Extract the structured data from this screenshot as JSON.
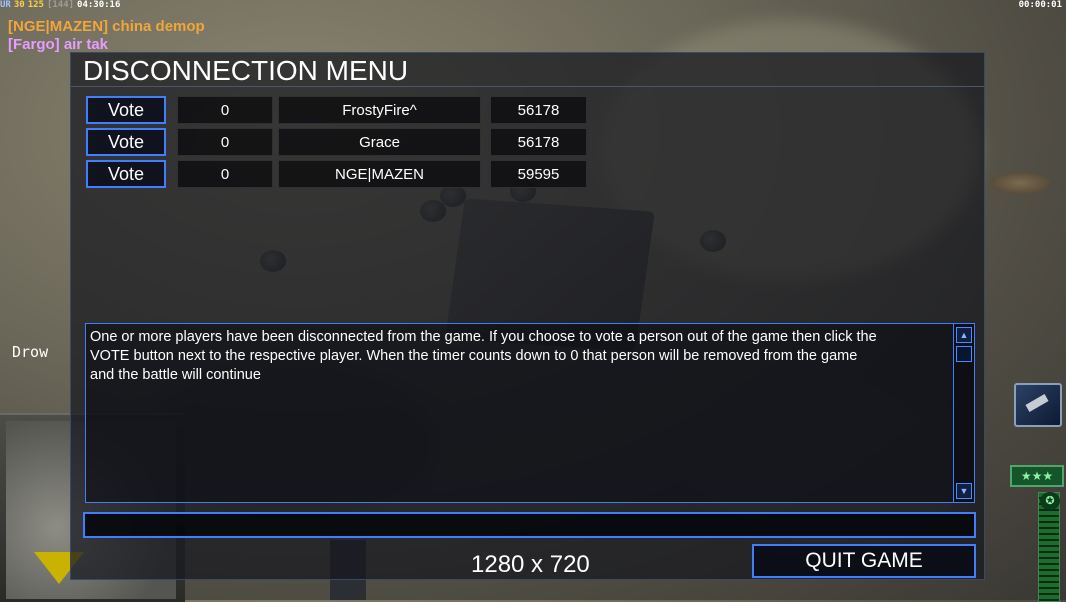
{
  "hud": {
    "stats": [
      {
        "text": "UR",
        "color": "#9ec3ff"
      },
      {
        "text": "30",
        "color": "#f7d14a"
      },
      {
        "text": "125",
        "color": "#f7d14a"
      },
      {
        "text": "[144]",
        "color": "#9c9c9c"
      },
      {
        "text": "04:30:16",
        "color": "#ffffff"
      }
    ],
    "clock": "00:00:01",
    "chat": [
      {
        "text": "[NGE|MAZEN] china demop",
        "color": "#f0a63a"
      },
      {
        "text": "[Fargo] air  tak",
        "color": "#e79cff"
      }
    ],
    "side_label": "Drow",
    "rank_stars": "★★★"
  },
  "dialog": {
    "title": "DISCONNECTION MENU",
    "players": [
      {
        "vote_label": "Vote",
        "count": "0",
        "name": "FrostyFire^",
        "value": "56178"
      },
      {
        "vote_label": "Vote",
        "count": "0",
        "name": "Grace",
        "value": "56178"
      },
      {
        "vote_label": "Vote",
        "count": "0",
        "name": "NGE|MAZEN",
        "value": "59595"
      }
    ],
    "message": "One or more players have been disconnected from the game. If you choose to vote a person out of the game then click the\n VOTE button next to the respective player. When the timer counts down to 0 that person will be removed from the game\n and the battle will continue",
    "chat_input_value": "",
    "resolution_label": "1280 x 720",
    "quit_label": "QUIT GAME"
  },
  "colors": {
    "accent": "#3f7fff",
    "panel": "#16181e"
  }
}
